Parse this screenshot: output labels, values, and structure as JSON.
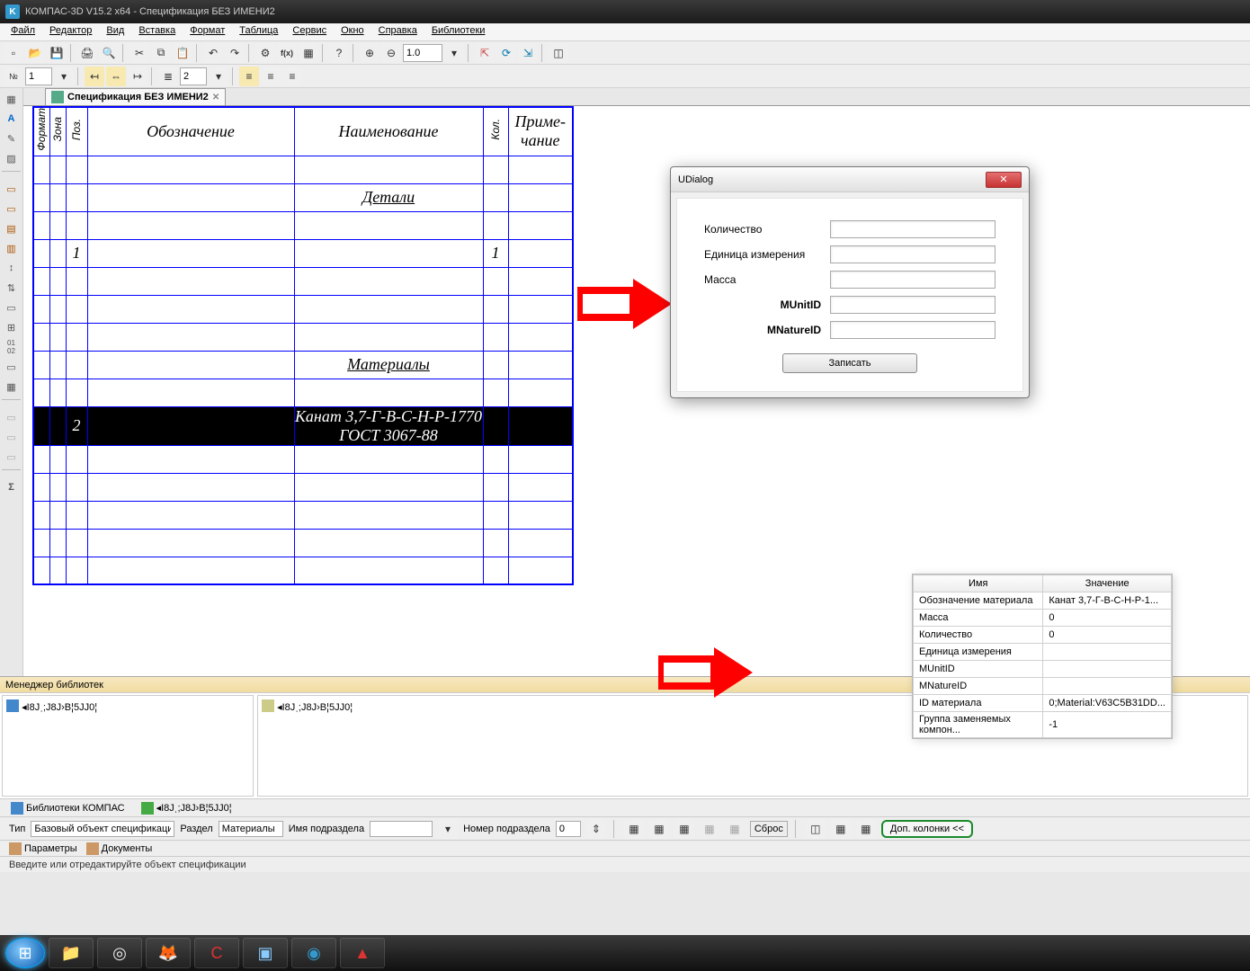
{
  "app": {
    "title": "КОМПАС-3D V15.2  x64 - Спецификация БЕЗ ИМЕНИ2",
    "doc_tab": "Спецификация БЕЗ ИМЕНИ2"
  },
  "menus": [
    "Файл",
    "Редактор",
    "Вид",
    "Вставка",
    "Формат",
    "Таблица",
    "Сервис",
    "Окно",
    "Справка",
    "Библиотеки"
  ],
  "toolbar1": {
    "zoom": "1.0"
  },
  "toolbar2": {
    "no": "1",
    "step": "2"
  },
  "spec": {
    "headers": {
      "fmt": "Формат",
      "zona": "Зона",
      "poz": "Поз.",
      "obozn": "Обозначение",
      "naim": "Наименование",
      "kol": "Кол.",
      "prim": "Приме-\nчание"
    },
    "rows": [
      {
        "fmt": "",
        "zona": "",
        "poz": "",
        "obozn": "",
        "naim": "",
        "kol": "",
        "prim": ""
      },
      {
        "fmt": "",
        "zona": "",
        "poz": "",
        "obozn": "",
        "naim": "Детали",
        "kol": "",
        "prim": "",
        "section": true,
        "underline": true
      },
      {
        "fmt": "",
        "zona": "",
        "poz": "",
        "obozn": "",
        "naim": "",
        "kol": "",
        "prim": ""
      },
      {
        "fmt": "",
        "zona": "",
        "poz": "1",
        "obozn": "",
        "naim": "",
        "kol": "1",
        "prim": ""
      },
      {
        "fmt": "",
        "zona": "",
        "poz": "",
        "obozn": "",
        "naim": "",
        "kol": "",
        "prim": ""
      },
      {
        "fmt": "",
        "zona": "",
        "poz": "",
        "obozn": "",
        "naim": "",
        "kol": "",
        "prim": ""
      },
      {
        "fmt": "",
        "zona": "",
        "poz": "",
        "obozn": "",
        "naim": "",
        "kol": "",
        "prim": ""
      },
      {
        "fmt": "",
        "zona": "",
        "poz": "",
        "obozn": "",
        "naim": "Материалы",
        "kol": "",
        "prim": "",
        "section": true,
        "underline": true
      },
      {
        "fmt": "",
        "zona": "",
        "poz": "",
        "obozn": "",
        "naim": "",
        "kol": "",
        "prim": ""
      },
      {
        "fmt": "",
        "zona": "",
        "poz": "2",
        "obozn": "",
        "naim": "Канат 3,7-Г-В-С-Н-Р-1770 ГОСТ 3067-88",
        "kol": "",
        "prim": "",
        "selected": true
      },
      {
        "fmt": "",
        "zona": "",
        "poz": "",
        "obozn": "",
        "naim": "",
        "kol": "",
        "prim": ""
      },
      {
        "fmt": "",
        "zona": "",
        "poz": "",
        "obozn": "",
        "naim": "",
        "kol": "",
        "prim": ""
      },
      {
        "fmt": "",
        "zona": "",
        "poz": "",
        "obozn": "",
        "naim": "",
        "kol": "",
        "prim": ""
      },
      {
        "fmt": "",
        "zona": "",
        "poz": "",
        "obozn": "",
        "naim": "",
        "kol": "",
        "prim": ""
      },
      {
        "fmt": "",
        "zona": "",
        "poz": "",
        "obozn": "",
        "naim": "",
        "kol": "",
        "prim": ""
      }
    ]
  },
  "udialog": {
    "title": "UDialog",
    "fields": {
      "qty": "Количество",
      "unit": "Единица измерения",
      "mass": "Масса",
      "munit": "MUnitID",
      "mnat": "MNatureID"
    },
    "values": {
      "qty": "",
      "unit": "",
      "mass": "",
      "munit": "",
      "mnat": ""
    },
    "btn": "Записать"
  },
  "propgrid": {
    "head_name": "Имя",
    "head_val": "Значение",
    "rows": [
      {
        "n": "Обозначение материала",
        "v": "Канат 3,7-Г-В-С-Н-Р-1..."
      },
      {
        "n": "Масса",
        "v": "0"
      },
      {
        "n": "Количество",
        "v": "0"
      },
      {
        "n": "Единица измерения",
        "v": ""
      },
      {
        "n": "MUnitID",
        "v": ""
      },
      {
        "n": "MNatureID",
        "v": ""
      },
      {
        "n": "ID материала",
        "v": "0;Material:V63C5B31DD..."
      },
      {
        "n": "Группа заменяемых компон...",
        "v": "-1"
      }
    ]
  },
  "libmgr": {
    "title": "Менеджер библиотек",
    "item": "◂І8Јˌ;Ј8Ј›В¦5ЈЈ0¦",
    "tab1": "Библиотеки КОМПАС",
    "tab2": "◂І8Јˌ;Ј8Ј›В¦5ЈЈ0¦"
  },
  "param": {
    "tip_lbl": "Тип",
    "tip_val": "Базовый объект спецификации",
    "razdel_lbl": "Раздел",
    "razdel_val": "Материалы",
    "imya_lbl": "Имя подраздела",
    "imya_val": "",
    "nomer_lbl": "Номер подраздела",
    "nomer_val": "0",
    "sbros": "Сброс",
    "dop": "Доп. колонки  <<",
    "tab_param": "Параметры",
    "tab_doc": "Документы"
  },
  "status": "Введите или отредактируйте объект спецификации"
}
